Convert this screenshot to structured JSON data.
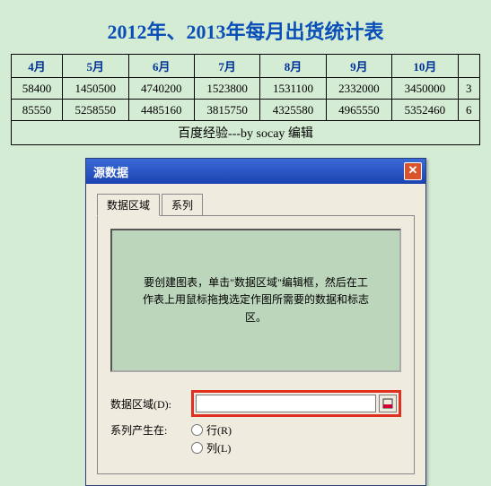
{
  "sheet": {
    "title": "2012年、2013年每月出货统计表",
    "headers": [
      "4月",
      "5月",
      "6月",
      "7月",
      "8月",
      "9月",
      "10月",
      ""
    ],
    "rows": [
      [
        "58400",
        "1450500",
        "4740200",
        "1523800",
        "1531100",
        "2332000",
        "3450000",
        "3"
      ],
      [
        "85550",
        "5258550",
        "4485160",
        "3815750",
        "4325580",
        "4965550",
        "5352460",
        "6"
      ]
    ],
    "footer": "百度经验---by socay 编辑"
  },
  "dialog": {
    "title": "源数据",
    "tabs": {
      "range": "数据区域",
      "series": "系列"
    },
    "preview_msg": "要创建图表，单击\"数据区域\"编辑框，然后在工作表上用鼠标拖拽选定作图所需要的数据和标志区。",
    "labels": {
      "data_range": "数据区域(D):",
      "series_in": "系列产生在:",
      "row_opt": "行(R)",
      "col_opt": "列(L)"
    },
    "data_range_value": ""
  }
}
